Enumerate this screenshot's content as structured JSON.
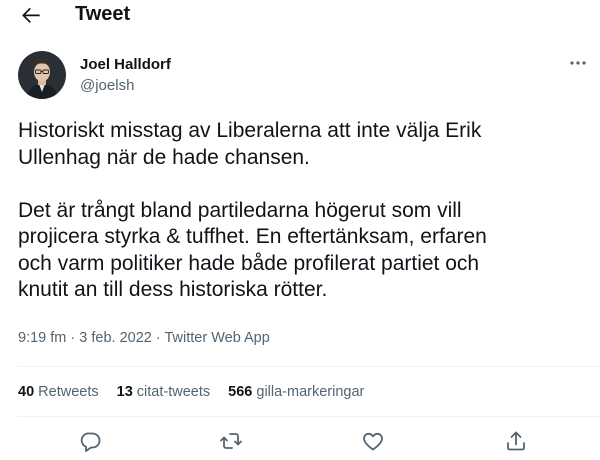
{
  "header": {
    "title": "Tweet"
  },
  "author": {
    "name": "Joel Halldorf",
    "handle": "@joelsh"
  },
  "tweet": {
    "paragraphs": [
      [
        "Historiskt misstag av Liberalerna att inte välja Erik",
        "Ullenhag när de hade chansen."
      ],
      [
        "Det är trångt bland partiledarna högerut som vill",
        "projicera styrka & tuffhet. En eftertänksam, erfaren",
        "och varm politiker hade både profilerat partiet och",
        "knutit an till dess historiska rötter."
      ]
    ],
    "time": "9:19 fm",
    "separator": "·",
    "date": "3 feb. 2022",
    "source": "Twitter Web App"
  },
  "stats": {
    "retweets_count": "40",
    "retweets_label": "Retweets",
    "quotes_count": "13",
    "quotes_label": "citat-tweets",
    "likes_count": "566",
    "likes_label": "gilla-markeringar"
  },
  "icons": {
    "back": "arrow-left-icon",
    "more": "more-icon",
    "reply": "reply-icon",
    "retweet": "retweet-icon",
    "like": "heart-icon",
    "share": "share-icon"
  },
  "colors": {
    "text": "#0f1419",
    "secondary": "#536471",
    "divider": "#eff3f4"
  }
}
